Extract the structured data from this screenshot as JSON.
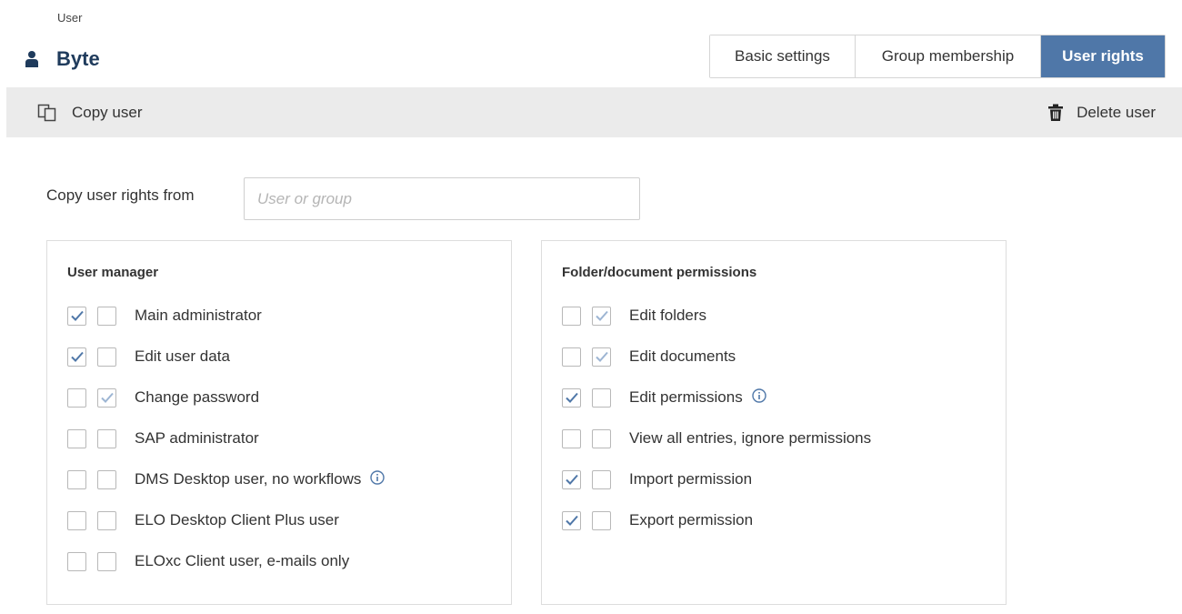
{
  "breadcrumb": "User",
  "header": {
    "title": "Byte"
  },
  "tabs": [
    {
      "label": "Basic settings",
      "active": false
    },
    {
      "label": "Group membership",
      "active": false
    },
    {
      "label": "User rights",
      "active": true
    }
  ],
  "toolbar": {
    "copy_label": "Copy user",
    "delete_label": "Delete user"
  },
  "copy_rights": {
    "label": "Copy user rights from",
    "placeholder": "User or group",
    "value": ""
  },
  "colors": {
    "accent": "#4f77a8",
    "check": "#4f77a8",
    "inherited_check": "#9db5d3",
    "title": "#1f3b5c"
  },
  "user_manager": {
    "title": "User manager",
    "items": [
      {
        "label": "Main administrator",
        "checked": true,
        "inherited": false,
        "info": false
      },
      {
        "label": "Edit user data",
        "checked": true,
        "inherited": false,
        "info": false
      },
      {
        "label": "Change password",
        "checked": false,
        "inherited": true,
        "info": false
      },
      {
        "label": "SAP administrator",
        "checked": false,
        "inherited": false,
        "info": false
      },
      {
        "label": "DMS Desktop user, no workflows",
        "checked": false,
        "inherited": false,
        "info": true
      },
      {
        "label": "ELO Desktop Client Plus user",
        "checked": false,
        "inherited": false,
        "info": false
      },
      {
        "label": "ELOxc Client user, e-mails only",
        "checked": false,
        "inherited": false,
        "info": false
      }
    ]
  },
  "folder_permissions": {
    "title": "Folder/document permissions",
    "items": [
      {
        "label": "Edit folders",
        "checked": false,
        "inherited": true,
        "info": false
      },
      {
        "label": "Edit documents",
        "checked": false,
        "inherited": true,
        "info": false
      },
      {
        "label": "Edit permissions",
        "checked": true,
        "inherited": false,
        "info": true
      },
      {
        "label": "View all entries, ignore permissions",
        "checked": false,
        "inherited": false,
        "info": false
      },
      {
        "label": "Import permission",
        "checked": true,
        "inherited": false,
        "info": false
      },
      {
        "label": "Export permission",
        "checked": true,
        "inherited": false,
        "info": false
      }
    ]
  }
}
